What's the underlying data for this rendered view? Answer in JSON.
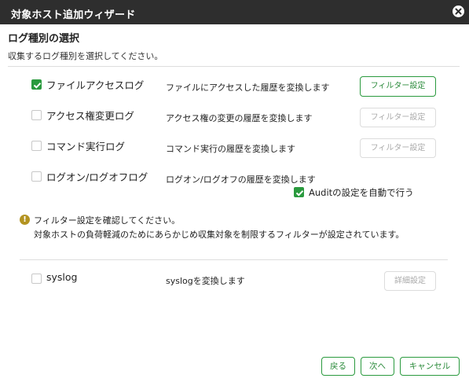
{
  "window": {
    "title": "対象ホスト追加ウィザード"
  },
  "section": {
    "title": "ログ種別の選択",
    "description": "収集するログ種別を選択してください。"
  },
  "log_types": [
    {
      "label": "ファイルアクセスログ",
      "description": "ファイルにアクセスした履歴を変換します",
      "checked": true,
      "button": "フィルター設定",
      "button_enabled": true
    },
    {
      "label": "アクセス権変更ログ",
      "description": "アクセス権の変更の履歴を変換します",
      "checked": false,
      "button": "フィルター設定",
      "button_enabled": false
    },
    {
      "label": "コマンド実行ログ",
      "description": "コマンド実行の履歴を変換します",
      "checked": false,
      "button": "フィルター設定",
      "button_enabled": false
    },
    {
      "label": "ログオン/ログオフログ",
      "description": "ログオン/ログオフの履歴を変換します",
      "checked": false
    }
  ],
  "audit_option": {
    "label": "Auditの設定を自動で行う",
    "checked": true
  },
  "notice": {
    "line1": "フィルター設定を確認してください。",
    "line2": "対象ホストの負荷軽減のためにあらかじめ収集対象を制限するフィルターが設定されています。"
  },
  "syslog": {
    "label": "syslog",
    "description": "syslogを変換します",
    "checked": false,
    "button": "詳細設定",
    "button_enabled": false
  },
  "footer": {
    "back": "戻る",
    "next": "次へ",
    "cancel": "キャンセル"
  },
  "colors": {
    "accent": "#2a9a3e",
    "titlebar": "#2e2e2e",
    "warning": "#b39320"
  }
}
